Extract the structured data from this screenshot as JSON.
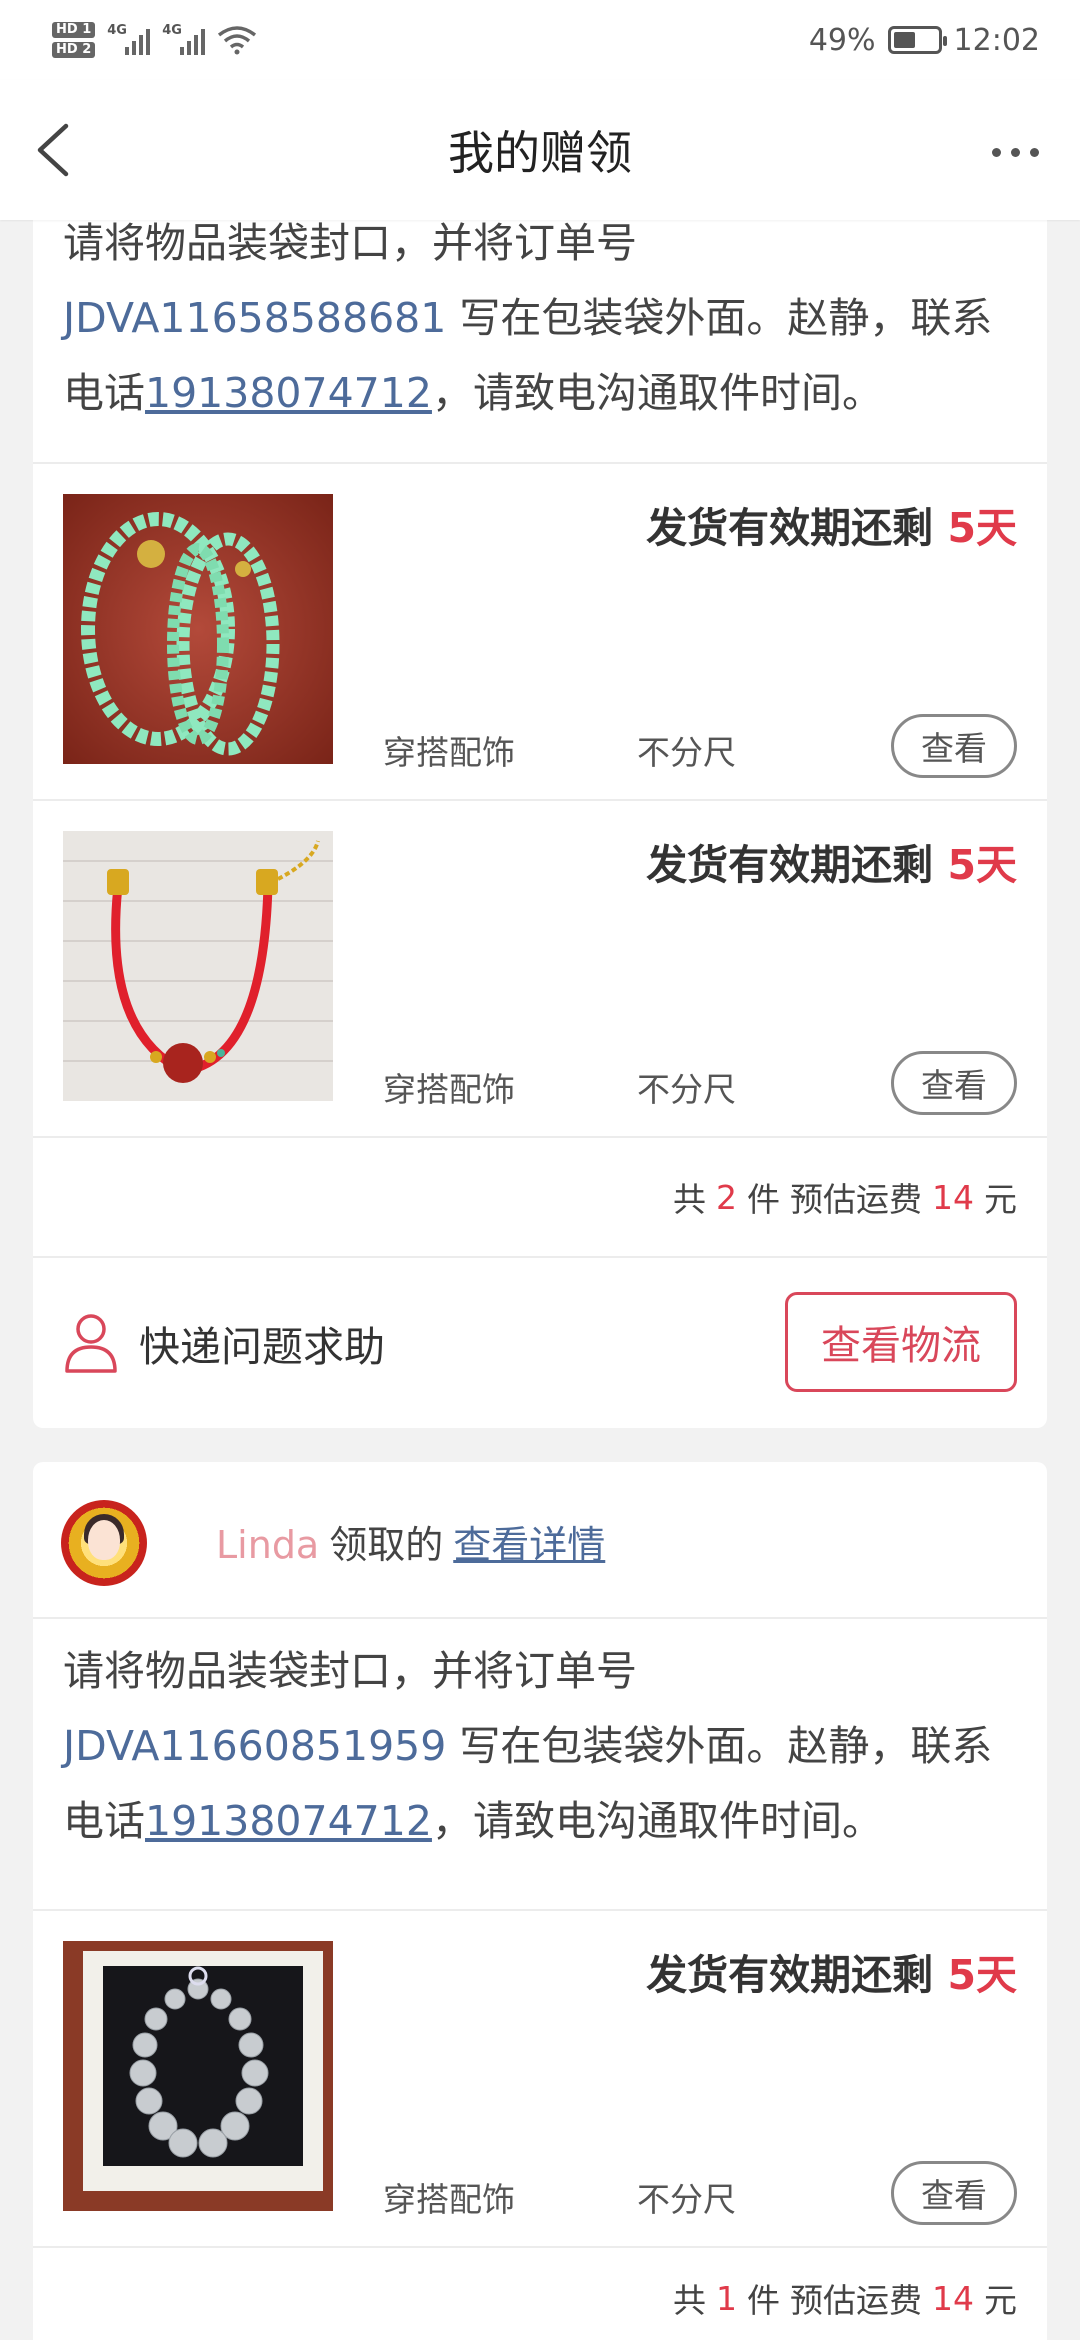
{
  "status_bar": {
    "hd1": "HD 1",
    "hd2": "HD 2",
    "net1": "4G",
    "net2": "4G",
    "battery_percent": "49%",
    "battery_level": 0.49,
    "time": "12:02"
  },
  "nav": {
    "title": "我的赠领"
  },
  "card1": {
    "notice": {
      "prefix": "请将物品装袋封口，并将订单号 ",
      "order_no": "JDVA11658588681",
      "middle": " 写在包装袋外面。赵静，联系电话",
      "phone": "19138074712",
      "suffix": "，请致电沟通取件时间。"
    },
    "items": [
      {
        "deadline_label": "发货有效期还剩 ",
        "deadline_days": "5天",
        "category": "穿搭配饰",
        "size": "不分尺",
        "view_label": "查看"
      },
      {
        "deadline_label": "发货有效期还剩 ",
        "deadline_days": "5天",
        "category": "穿搭配饰",
        "size": "不分尺",
        "view_label": "查看"
      }
    ],
    "summary": {
      "total_prefix": "共",
      "count": "2",
      "count_suffix": "件",
      "fee_label": "预估运费",
      "fee": "14",
      "fee_unit": "元"
    },
    "help_text": "快递问题求助",
    "logistics_label": "查看物流"
  },
  "card2": {
    "receiver_name": "Linda",
    "receiver_taken": "领取的",
    "details_link": "查看详情",
    "notice": {
      "prefix": "请将物品装袋封口，并将订单号 ",
      "order_no": "JDVA11660851959",
      "middle": " 写在包装袋外面。赵静，联系电话",
      "phone": "19138074712",
      "suffix": "，请致电沟通取件时间。"
    },
    "items": [
      {
        "deadline_label": "发货有效期还剩 ",
        "deadline_days": "5天",
        "category": "穿搭配饰",
        "size": "不分尺",
        "view_label": "查看"
      }
    ],
    "summary": {
      "total_prefix": "共",
      "count": "1",
      "count_suffix": "件",
      "fee_label": "预估运费",
      "fee": "14",
      "fee_unit": "元"
    }
  },
  "colors": {
    "accent_red": "#e03a4a",
    "link_blue": "#4d6b9a",
    "name_pink": "#e89aa2"
  }
}
